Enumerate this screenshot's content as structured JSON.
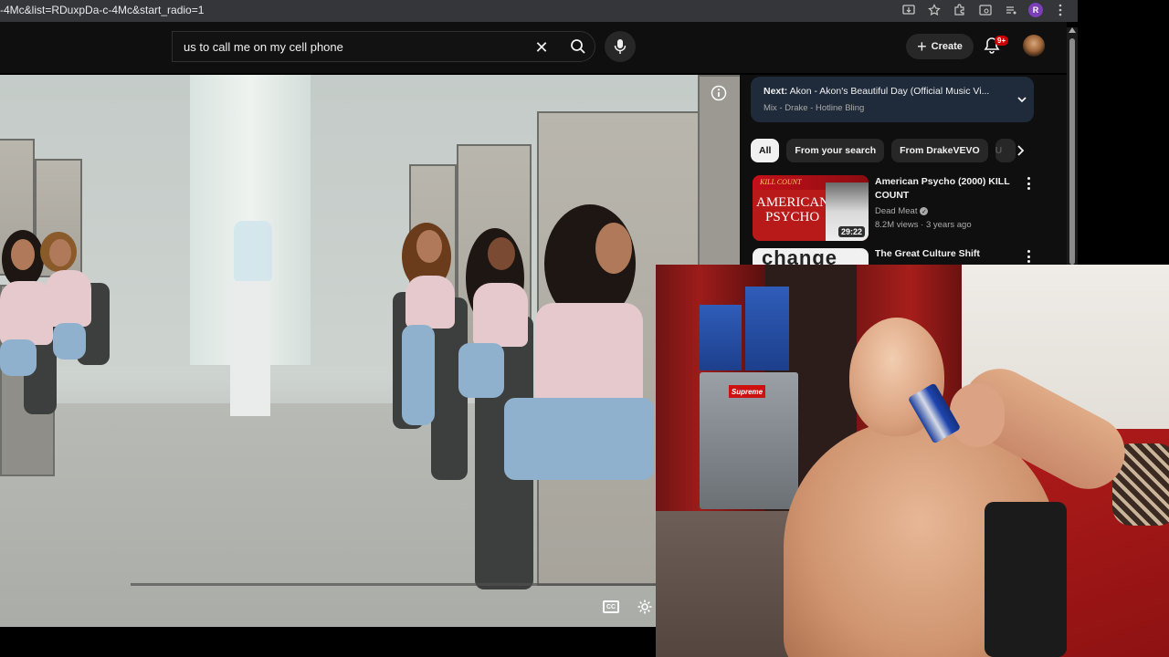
{
  "browser": {
    "url": "-4Mc&list=RDuxpDa-c-4Mc&start_radio=1",
    "profile_initial": "R"
  },
  "header": {
    "search_value": "us to call me on my cell phone",
    "create_label": "Create",
    "notification_badge": "9+"
  },
  "player": {
    "cc_label": "CC"
  },
  "up_next": {
    "prefix": "Next:",
    "title": "Akon - Akon's Beautiful Day (Official Music Vi...",
    "subtitle": "Mix - Drake - Hotline Bling"
  },
  "chips": [
    "All",
    "From your search",
    "From DrakeVEVO",
    "U"
  ],
  "recommendations": [
    {
      "title": "American Psycho (2000) KILL COUNT",
      "channel": "Dead Meat",
      "views": "8.2M views",
      "age": "3 years ago",
      "duration": "29:22",
      "thumb_text_top": "KILL COUNT",
      "thumb_text_1": "AMERICAN",
      "thumb_text_2": "PSYCHO"
    },
    {
      "title": "The Great Culture Shift",
      "thumb_text": "change"
    }
  ],
  "webcam": {
    "sticker_text": "Supreme"
  },
  "colors": {
    "yt_background": "#0f0f0f",
    "chip_bg": "#272727",
    "next_card_bg": "#1f2a3a",
    "badge_red": "#cc0000"
  }
}
